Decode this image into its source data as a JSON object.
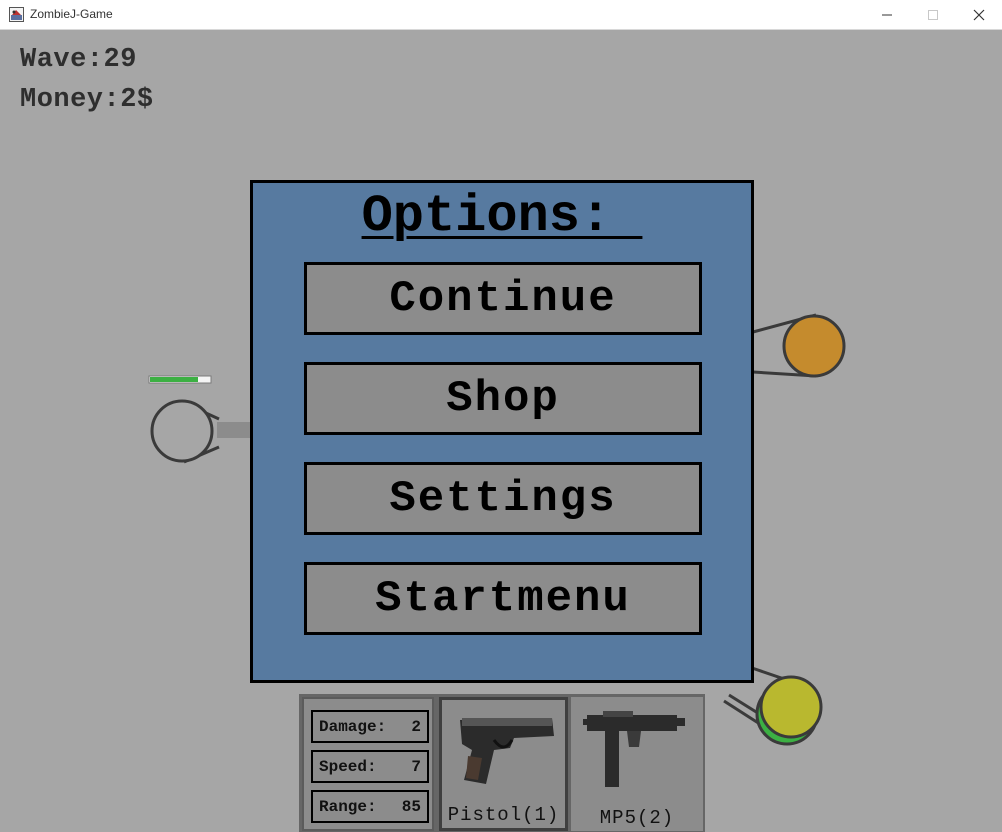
{
  "window": {
    "title": "ZombieJ-Game"
  },
  "hud": {
    "wave": "Wave:29",
    "money": "Money:2$"
  },
  "player": {
    "health_fraction": 0.8
  },
  "options_menu": {
    "title": "Options: ",
    "buttons": [
      "Continue",
      "Shop",
      "Settings",
      "Startmenu"
    ]
  },
  "weapon_stats": {
    "damage_label": "Damage:",
    "damage_value": "2",
    "speed_label": "Speed:",
    "speed_value": "7",
    "range_label": "Range:",
    "range_value": "85"
  },
  "weapons": [
    {
      "name": "Pistol(1)",
      "icon": "pistol-icon",
      "selected": true
    },
    {
      "name": "MP5(2)",
      "icon": "mp5-icon",
      "selected": false
    }
  ],
  "colors": {
    "background": "#a6a6a6",
    "dialog": "#577aa0",
    "button": "#8c8c8c",
    "health": "#3cb043",
    "zombie_orange": "#c58b2d",
    "zombie_yellow": "#b9b82f"
  }
}
